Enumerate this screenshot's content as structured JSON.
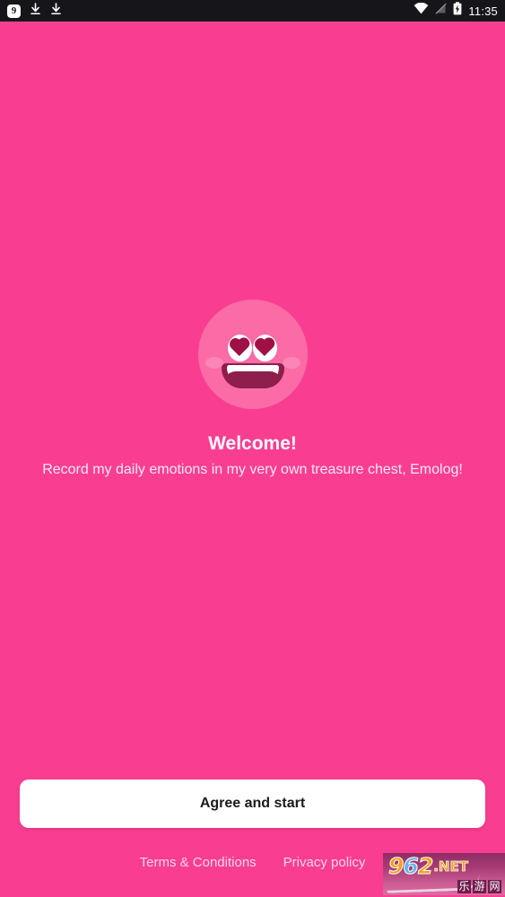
{
  "theme": {
    "background": "#F93E92",
    "face": "#FB6BA5",
    "accent_dark": "#8E1E4B",
    "button_bg": "#ffffff",
    "button_text": "#1A1A1E"
  },
  "status_bar": {
    "app_badge_label": "9",
    "left_icons": [
      "app-badge-icon",
      "download-icon",
      "download-icon"
    ],
    "right_icons": [
      "wifi-icon",
      "no-signal-icon",
      "battery-charging-icon"
    ],
    "time": "11:35"
  },
  "main": {
    "mascot": {
      "name": "emolog-heart-eyes-face",
      "eyes": "heart",
      "mouth": "smile"
    },
    "title": "Welcome!",
    "subtitle": "Record my daily emotions in my very own treasure chest, Emolog!"
  },
  "bottom": {
    "primary_button": "Agree and start",
    "links": [
      {
        "label": "Terms & Conditions",
        "name": "terms-and-conditions-link"
      },
      {
        "label": "Privacy policy",
        "name": "privacy-policy-link"
      }
    ]
  },
  "watermark": {
    "digit_1": "9",
    "digit_2": "6",
    "digit_3": "2",
    "tld": ".NET",
    "cn_1": "乐",
    "cn_2": "游",
    "cn_3": "网"
  }
}
